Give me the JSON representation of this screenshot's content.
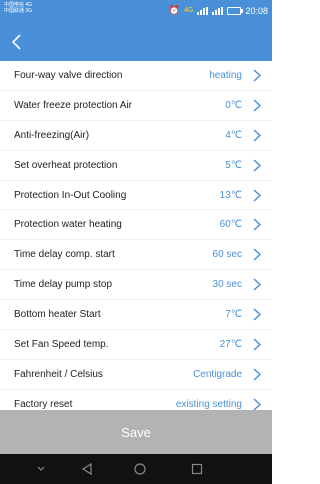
{
  "status": {
    "carrier_line1": "中国电信 4G",
    "carrier_line2": "中国联通 3G",
    "network": "4G",
    "time": "20:08"
  },
  "settings": [
    {
      "label": "Four-way valve direction",
      "value": "heating"
    },
    {
      "label": "Water freeze protection Air",
      "value": "0℃"
    },
    {
      "label": "Anti-freezing(Air)",
      "value": "4℃"
    },
    {
      "label": "Set overheat protection",
      "value": "5℃"
    },
    {
      "label": "Protection In-Out Cooling",
      "value": "13℃"
    },
    {
      "label": "Protection water heating",
      "value": "60℃"
    },
    {
      "label": "Time delay comp. start",
      "value": "60 sec"
    },
    {
      "label": "Time delay pump stop",
      "value": "30 sec"
    },
    {
      "label": "Bottom heater Start",
      "value": "7℃"
    },
    {
      "label": "Set Fan Speed temp.",
      "value": "27℃"
    },
    {
      "label": "Fahrenheit / Celsius",
      "value": "Centigrade"
    },
    {
      "label": "Factory reset",
      "value": "existing setting"
    }
  ],
  "save_label": "Save",
  "colors": {
    "accent": "#4a90d8",
    "save_bg": "#b3b3b3",
    "nav_bg": "#111111"
  }
}
